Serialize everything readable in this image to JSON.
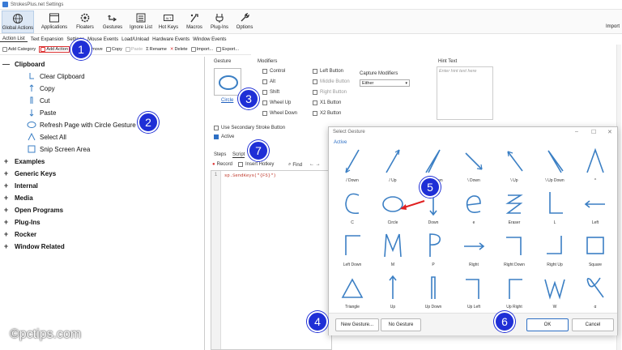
{
  "window": {
    "title": "StrokesPlus.net Settings"
  },
  "ribbon": {
    "buttons": [
      {
        "label": "Global Actions",
        "icon": "globe-icon"
      },
      {
        "label": "Applications",
        "icon": "window-icon"
      },
      {
        "label": "Floaters",
        "icon": "gear-icon"
      },
      {
        "label": "Gestures",
        "icon": "gesture-icon"
      },
      {
        "label": "Ignore List",
        "icon": "list-icon"
      },
      {
        "label": "Hot Keys",
        "icon": "keyboard-icon"
      },
      {
        "label": "Macros",
        "icon": "macros-icon"
      },
      {
        "label": "Plug-Ins",
        "icon": "plug-icon"
      },
      {
        "label": "Options",
        "icon": "wrench-icon"
      }
    ],
    "right_label": "Import"
  },
  "tabs": [
    "Action List",
    "Text Expansion",
    "Settings",
    "Mouse Events",
    "Load/Unload",
    "Hardware Events",
    "Window Events"
  ],
  "toolbar": {
    "add_category": "Add Category",
    "add_action": "Add Action",
    "remove": "Remove",
    "copy": "Copy",
    "paste": "Paste",
    "rename": "Rename",
    "delete": "Delete",
    "import": "Import...",
    "export": "Export..."
  },
  "tree": {
    "clipboard": "Clipboard",
    "items": [
      "Clear Clipboard",
      "Copy",
      "Cut",
      "Paste",
      "Refresh Page with Circle Gesture",
      "Select All",
      "Snip Screen Area"
    ],
    "groups": [
      "Examples",
      "Generic Keys",
      "Internal",
      "Media",
      "Open Programs",
      "Plug-Ins",
      "Rocker",
      "Window Related"
    ]
  },
  "details": {
    "gesture_label": "Gesture",
    "gesture_name": "Circle",
    "modifiers_label": "Modifiers",
    "modifiers_left": [
      "Control",
      "Alt",
      "Shift",
      "Wheel Up",
      "Wheel Down"
    ],
    "modifiers_right": [
      "Left Button",
      "Middle Button",
      "Right Button",
      "X1 Button",
      "X2 Button"
    ],
    "capture_label": "Capture Modifiers",
    "capture_value": "Either",
    "hint_label": "Hint Text",
    "hint_placeholder": "Enter hint text here",
    "secondary_stroke": "Use Secondary Stroke Button",
    "active": "Active"
  },
  "editor": {
    "tab_steps": "Steps",
    "tab_script": "Script",
    "record": "Record",
    "insert_hotkey": "Insert Hotkey",
    "find": "Find",
    "line_no": "1",
    "code": "sp.SendKeys(\"{F5}\")"
  },
  "dialog": {
    "title": "Select Gesture",
    "tab": "Active",
    "gestures": [
      "/ Down",
      "/ Up",
      "/ Up Down",
      "\\ Down",
      "\\ Up",
      "\\ Up Down",
      "^",
      "C",
      "Circle",
      "Down",
      "e",
      "Eraser",
      "L",
      "Left",
      "Left Down",
      "M",
      "P",
      "Right",
      "Right Down",
      "Right Up",
      "Square",
      "Triangle",
      "Up",
      "Up Down",
      "Up Left",
      "Up Right",
      "W",
      "α"
    ],
    "new_gesture": "New Gesture...",
    "no_gesture": "No Gesture",
    "ok": "OK",
    "cancel": "Cancel"
  },
  "badges": [
    "1",
    "2",
    "3",
    "4",
    "5",
    "6",
    "7"
  ],
  "watermark": "©pctips.com",
  "colors": {
    "badge": "#1f2fd6",
    "accent": "#2d6fc4",
    "stroke": "#3b7fc4",
    "code": "#c0392b"
  }
}
